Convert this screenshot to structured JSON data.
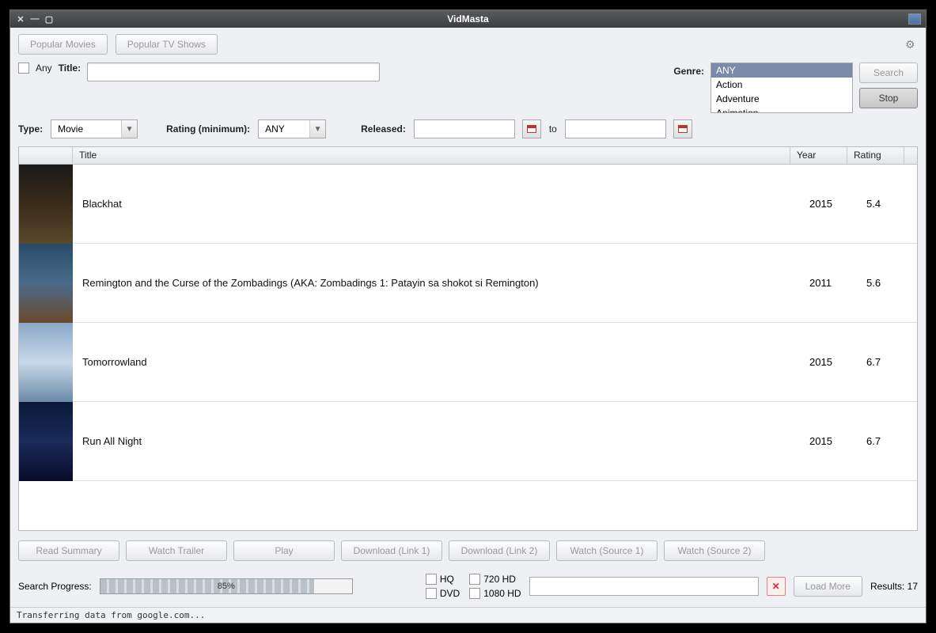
{
  "titlebar": {
    "title": "VidMasta"
  },
  "top": {
    "popular_movies": "Popular Movies",
    "popular_tv": "Popular TV Shows"
  },
  "search": {
    "any_label": "Any",
    "title_label": "Title:",
    "title_value": "",
    "genre_label": "Genre:",
    "genres": [
      "ANY",
      "Action",
      "Adventure",
      "Animation"
    ],
    "search_btn": "Search",
    "stop_btn": "Stop"
  },
  "filters": {
    "type_label": "Type:",
    "type_value": "Movie",
    "rating_label": "Rating (minimum):",
    "rating_value": "ANY",
    "released_label": "Released:",
    "released_from": "",
    "to_label": "to",
    "released_to": ""
  },
  "columns": {
    "title": "Title",
    "year": "Year",
    "rating": "Rating"
  },
  "rows": [
    {
      "title": "Blackhat",
      "year": "2015",
      "rating": "5.4",
      "poster": "poster1"
    },
    {
      "title": "Remington and the Curse of the Zombadings (AKA: Zombadings 1: Patayin sa shokot si Remington)",
      "year": "2011",
      "rating": "5.6",
      "poster": "poster2"
    },
    {
      "title": "Tomorrowland",
      "year": "2015",
      "rating": "6.7",
      "poster": "poster3"
    },
    {
      "title": "Run All Night",
      "year": "2015",
      "rating": "6.7",
      "poster": "poster4"
    }
  ],
  "actions": {
    "read_summary": "Read Summary",
    "watch_trailer": "Watch Trailer",
    "play": "Play",
    "dl1": "Download (Link 1)",
    "dl2": "Download (Link 2)",
    "ws1": "Watch (Source 1)",
    "ws2": "Watch (Source 2)"
  },
  "bottom": {
    "progress_label": "Search Progress:",
    "progress_pct": "85%",
    "progress_val": 85,
    "hq": "HQ",
    "hd720": "720 HD",
    "dvd": "DVD",
    "hd1080": "1080 HD",
    "filter_value": "",
    "load_more": "Load More",
    "results": "Results: 17"
  },
  "status": "Transferring data from google.com..."
}
